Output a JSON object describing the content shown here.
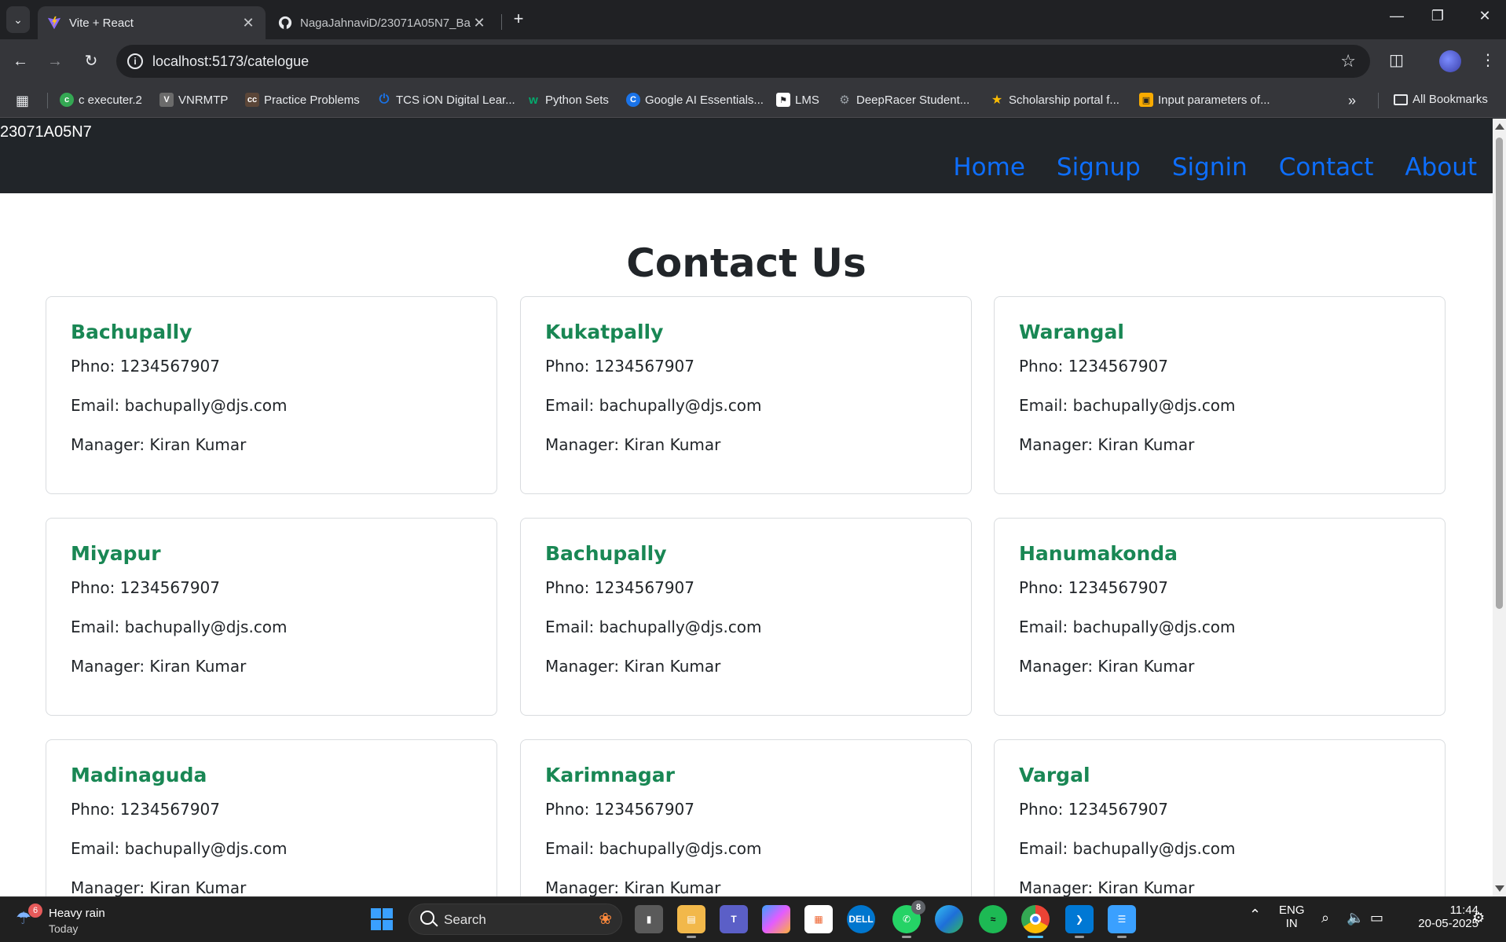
{
  "browser": {
    "tabs": [
      {
        "title": "Vite + React",
        "active": true,
        "icon": "vite-icon"
      },
      {
        "title": "NagaJahnaviD/23071A05N7_Ba",
        "active": false,
        "icon": "github-icon"
      }
    ],
    "url": "localhost:5173/catelogue",
    "bookmarks": [
      {
        "label": "c executer.2",
        "icon": "c-executer-icon",
        "color": "#34a853"
      },
      {
        "label": "VNRMTP",
        "icon": "vnrmtp-icon",
        "color": "#6b6b6b"
      },
      {
        "label": "Practice Problems",
        "icon": "codechef-icon",
        "color": "#5b4638"
      },
      {
        "label": "TCS iON Digital Lear...",
        "icon": "tcs-ion-icon",
        "color": "#1a73e8"
      },
      {
        "label": "Python Sets",
        "icon": "w3schools-icon",
        "color": "#04aa6d"
      },
      {
        "label": "Google AI Essentials...",
        "icon": "coursera-icon",
        "color": "#1a73e8"
      },
      {
        "label": "LMS",
        "icon": "lms-icon",
        "color": "#ffffff"
      },
      {
        "label": "DeepRacer Student...",
        "icon": "deepracer-icon",
        "color": "#9aa0a6"
      },
      {
        "label": "Scholarship portal f...",
        "icon": "scholarship-icon",
        "color": "#fbbc04"
      },
      {
        "label": "Input parameters of...",
        "icon": "package-icon",
        "color": "#f9ab00"
      }
    ],
    "all_bookmarks_label": "All Bookmarks"
  },
  "site": {
    "brand": "23071A05N7",
    "nav": [
      "Home",
      "Signup",
      "Signin",
      "Contact",
      "About"
    ],
    "nav_color": "#0d6efd",
    "header_bg": "#212529",
    "title": "Contact Us",
    "name_color": "#198754"
  },
  "branches": [
    {
      "name": "Bachupally",
      "phone": "Phno: 1234567907",
      "email": "Email: bachupally@djs.com",
      "manager": "Manager: Kiran Kumar"
    },
    {
      "name": "Kukatpally",
      "phone": "Phno: 1234567907",
      "email": "Email: bachupally@djs.com",
      "manager": "Manager: Kiran Kumar"
    },
    {
      "name": "Warangal",
      "phone": "Phno: 1234567907",
      "email": "Email: bachupally@djs.com",
      "manager": "Manager: Kiran Kumar"
    },
    {
      "name": "Miyapur",
      "phone": "Phno: 1234567907",
      "email": "Email: bachupally@djs.com",
      "manager": "Manager: Kiran Kumar"
    },
    {
      "name": "Bachupally",
      "phone": "Phno: 1234567907",
      "email": "Email: bachupally@djs.com",
      "manager": "Manager: Kiran Kumar"
    },
    {
      "name": "Hanumakonda",
      "phone": "Phno: 1234567907",
      "email": "Email: bachupally@djs.com",
      "manager": "Manager: Kiran Kumar"
    },
    {
      "name": "Madinaguda",
      "phone": "Phno: 1234567907",
      "email": "Email: bachupally@djs.com",
      "manager": "Manager: Kiran Kumar"
    },
    {
      "name": "Karimnagar",
      "phone": "Phno: 1234567907",
      "email": "Email: bachupally@djs.com",
      "manager": "Manager: Kiran Kumar"
    },
    {
      "name": "Vargal",
      "phone": "Phno: 1234567907",
      "email": "Email: bachupally@djs.com",
      "manager": "Manager: Kiran Kumar"
    }
  ],
  "taskbar": {
    "weather_badge": "6",
    "weather_title": "Heavy rain",
    "weather_sub": "Today",
    "search_label": "Search",
    "whatsapp_badge": "8",
    "language": "ENG",
    "region": "IN",
    "time": "11:44",
    "date": "20-05-2025",
    "apps": [
      "windows-start-icon",
      "task-view-icon",
      "file-explorer-icon",
      "teams-icon",
      "copilot-icon",
      "microsoft-store-icon",
      "dell-icon",
      "whatsapp-icon",
      "edge-icon",
      "spotify-icon",
      "chrome-icon",
      "vscode-icon",
      "notepad-icon"
    ]
  }
}
